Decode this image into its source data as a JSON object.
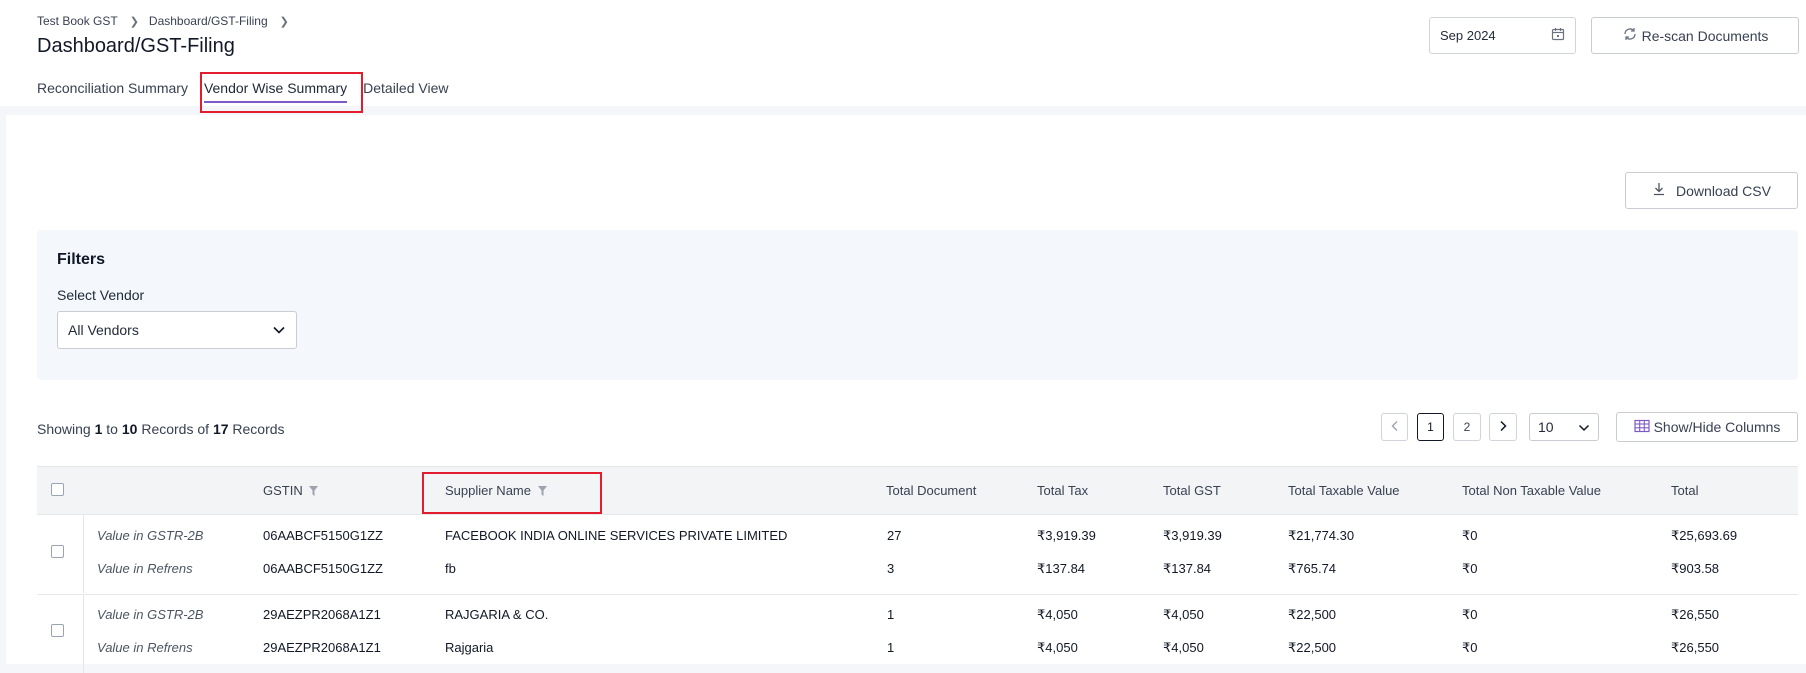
{
  "breadcrumb": [
    "Test Book GST",
    "Dashboard/GST-Filing"
  ],
  "page_title": "Dashboard/GST-Filing",
  "tabs": [
    {
      "label": "Reconciliation Summary",
      "active": false
    },
    {
      "label": "Vendor Wise Summary",
      "active": true
    },
    {
      "label": "Detailed View",
      "active": false
    }
  ],
  "date_picker": {
    "value": "Sep 2024"
  },
  "rescan_label": "Re-scan Documents",
  "download_label": "Download CSV",
  "filters": {
    "title": "Filters",
    "select_label": "Select Vendor",
    "select_value": "All Vendors"
  },
  "records": {
    "prefix": "Showing",
    "from": "1",
    "to_word": "to",
    "to": "10",
    "records_word": "Records",
    "of_word": "of",
    "total": "17",
    "suffix": "Records"
  },
  "pagination": {
    "pages": [
      "1",
      "2"
    ],
    "current": "1",
    "page_size": "10"
  },
  "columns_button": "Show/Hide Columns",
  "table": {
    "headers": [
      "GSTIN",
      "Supplier Name",
      "Total Document",
      "Total Tax",
      "Total GST",
      "Total Taxable Value",
      "Total Non Taxable Value",
      "Total"
    ],
    "groups": [
      {
        "rows": [
          {
            "source": "Value in GSTR-2B",
            "gstin": "06AABCF5150G1ZZ",
            "supplier": "FACEBOOK INDIA ONLINE SERVICES PRIVATE LIMITED",
            "docs": "27",
            "tax": "₹3,919.39",
            "gst": "₹3,919.39",
            "taxable": "₹21,774.30",
            "non_taxable": "₹0",
            "total": "₹25,693.69"
          },
          {
            "source": "Value in Refrens",
            "gstin": "06AABCF5150G1ZZ",
            "supplier": "fb",
            "docs": "3",
            "tax": "₹137.84",
            "gst": "₹137.84",
            "taxable": "₹765.74",
            "non_taxable": "₹0",
            "total": "₹903.58"
          }
        ]
      },
      {
        "rows": [
          {
            "source": "Value in GSTR-2B",
            "gstin": "29AEZPR2068A1Z1",
            "supplier": "RAJGARIA & CO.",
            "docs": "1",
            "tax": "₹4,050",
            "gst": "₹4,050",
            "taxable": "₹22,500",
            "non_taxable": "₹0",
            "total": "₹26,550"
          },
          {
            "source": "Value in Refrens",
            "gstin": "29AEZPR2068A1Z1",
            "supplier": "Rajgaria",
            "docs": "1",
            "tax": "₹4,050",
            "gst": "₹4,050",
            "taxable": "₹22,500",
            "non_taxable": "₹0",
            "total": "₹26,550"
          }
        ]
      }
    ]
  },
  "colors": {
    "accent": "#7c5cc4",
    "highlight": "#e11d2e"
  },
  "icons": [
    "chevron-right-icon",
    "calendar-icon",
    "refresh-icon",
    "download-icon",
    "chevron-down-icon",
    "chevron-left-icon",
    "columns-icon",
    "filter-icon"
  ]
}
